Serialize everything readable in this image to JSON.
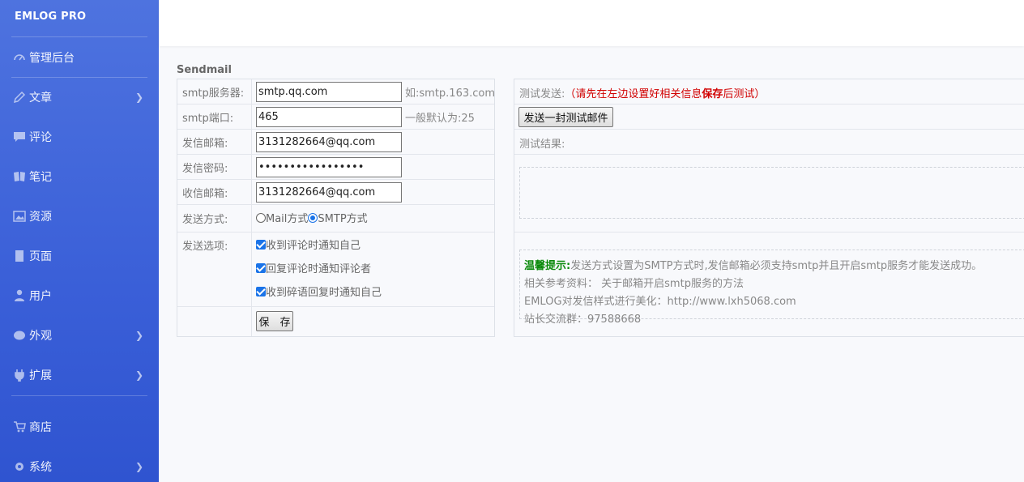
{
  "sidebar": {
    "brand": "EMLOG PRO",
    "items": [
      {
        "label": "管理后台",
        "icon": "dashboard-icon",
        "has_submenu": false
      },
      {
        "label": "文章",
        "icon": "pencil-icon",
        "has_submenu": true
      },
      {
        "label": "评论",
        "icon": "comment-icon",
        "has_submenu": false
      },
      {
        "label": "笔记",
        "icon": "note-icon",
        "has_submenu": false
      },
      {
        "label": "资源",
        "icon": "image-icon",
        "has_submenu": false
      },
      {
        "label": "页面",
        "icon": "page-icon",
        "has_submenu": false
      },
      {
        "label": "用户",
        "icon": "user-icon",
        "has_submenu": false
      },
      {
        "label": "外观",
        "icon": "palette-icon",
        "has_submenu": true
      },
      {
        "label": "扩展",
        "icon": "plug-icon",
        "has_submenu": true
      },
      {
        "label": "商店",
        "icon": "cart-icon",
        "has_submenu": false
      },
      {
        "label": "系统",
        "icon": "gear-icon",
        "has_submenu": true
      }
    ]
  },
  "page": {
    "section_title": "Sendmail"
  },
  "form": {
    "smtp_server": {
      "label": "smtp服务器:",
      "value": "smtp.qq.com",
      "hint": "如:smtp.163.com"
    },
    "smtp_port": {
      "label": "smtp端口:",
      "value": "465",
      "hint": "一般默认为:25"
    },
    "sender_email": {
      "label": "发信邮箱:",
      "value": "3131282664@qq.com"
    },
    "sender_password": {
      "label": "发信密码:",
      "value": "•••••••••••••••••"
    },
    "receiver_email": {
      "label": "收信邮箱:",
      "value": "3131282664@qq.com"
    },
    "send_method": {
      "label": "发送方式:",
      "option_mail": "Mail方式",
      "option_smtp": "SMTP方式",
      "selected": "SMTP方式"
    },
    "send_options": {
      "label": "发送选项:",
      "items": [
        {
          "label": "收到评论时通知自己",
          "checked": true
        },
        {
          "label": "回复评论时通知评论者",
          "checked": true
        },
        {
          "label": "收到碎语回复时通知自己",
          "checked": true
        }
      ]
    },
    "save_label": "保　存"
  },
  "test": {
    "prefix": "测试发送:",
    "note_before": "（请先在左边设置好相关信息",
    "note_bold": "保存",
    "note_after": "后测试）",
    "button_label": "发送一封测试邮件",
    "result_label": "测试结果:",
    "result_value": ""
  },
  "tips": {
    "title": "温馨提示:",
    "text": "发送方式设置为SMTP方式时,发信邮箱必须支持smtp并且开启smtp服务才能发送成功。",
    "ref_label": "相关参考资料：",
    "ref_link": "关于邮箱开启smtp服务的方法",
    "beautify_label": "EMLOG对发信样式进行美化：",
    "beautify_url": "http://www.lxh5068.com",
    "group_label": "站长交流群：",
    "group_number": "97588668"
  },
  "colors": {
    "sidebar_top": "#4e73df",
    "sidebar_bottom": "#2f54d0",
    "tip_green": "#0a8a0a",
    "note_red": "#d10000"
  }
}
